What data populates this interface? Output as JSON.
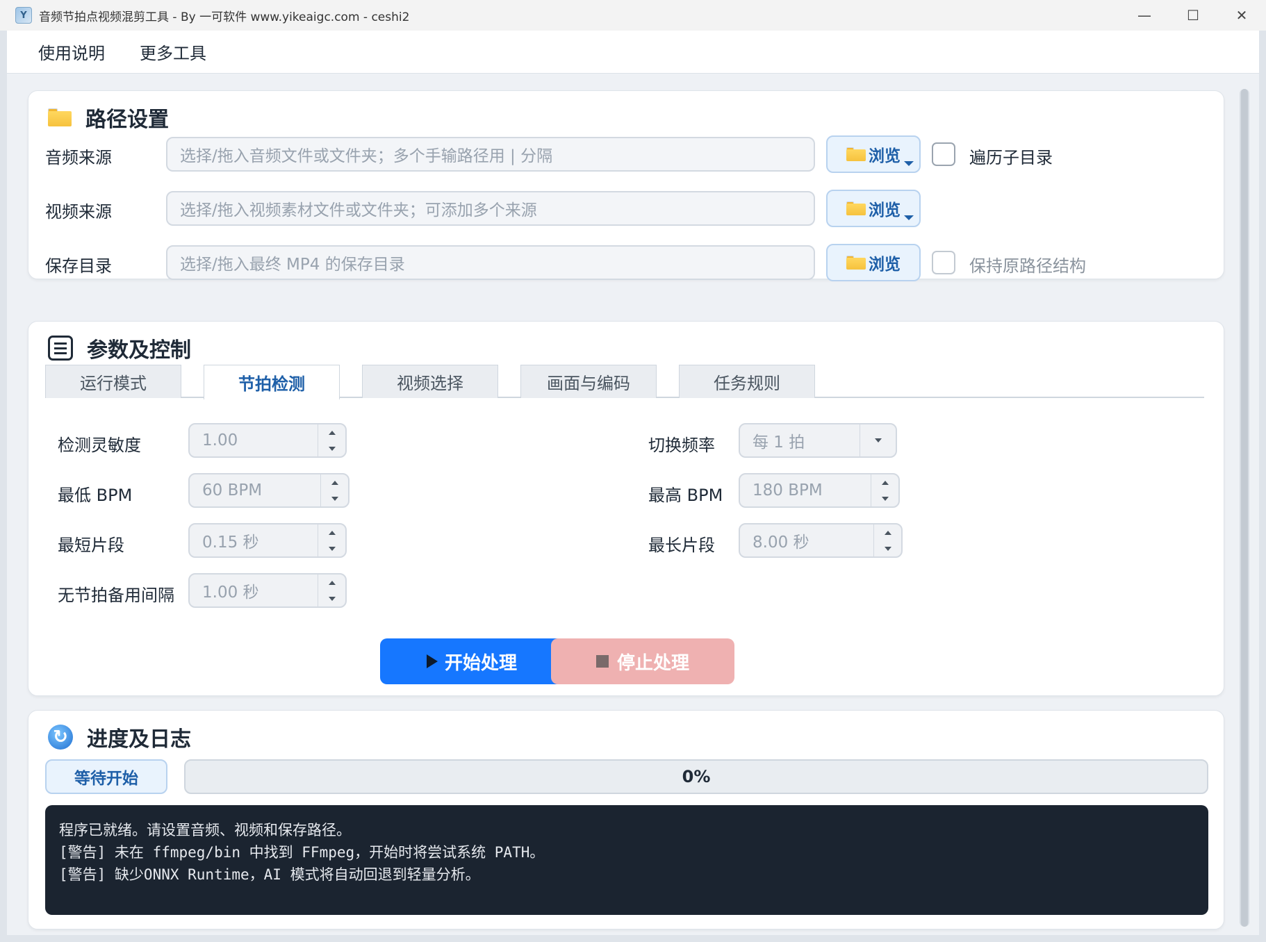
{
  "window": {
    "title": "音频节拍点视频混剪工具 - By 一可软件 www.yikeaigc.com - ceshi2",
    "minimize": "—",
    "maximize": "☐",
    "close": "✕"
  },
  "menu": [
    "使用说明",
    "更多工具"
  ],
  "paths": {
    "title": "路径设置",
    "audio": {
      "label": "音频来源",
      "placeholder": "选择/拖入音频文件或文件夹；多个手输路径用 | 分隔",
      "browse": "浏览",
      "checkbox": "遍历子目录",
      "checked": false
    },
    "video": {
      "label": "视频来源",
      "placeholder": "选择/拖入视频素材文件或文件夹；可添加多个来源",
      "browse": "浏览"
    },
    "save": {
      "label": "保存目录",
      "placeholder": "选择/拖入最终 MP4 的保存目录",
      "browse": "浏览",
      "checkbox": "保持原路径结构",
      "checked": false
    }
  },
  "params": {
    "title": "参数及控制",
    "tabs": [
      "运行模式",
      "节拍检测",
      "视频选择",
      "画面与编码",
      "任务规则"
    ],
    "active_tab": 1,
    "left": [
      {
        "label": "检测灵敏度",
        "value": "1.00"
      },
      {
        "label": "最低 BPM",
        "value": "60 BPM"
      },
      {
        "label": "最短片段",
        "value": "0.15 秒"
      },
      {
        "label": "无节拍备用间隔",
        "value": "1.00 秒"
      }
    ],
    "right": [
      {
        "label": "切换频率",
        "value": "每 1 拍",
        "type": "select"
      },
      {
        "label": "最高 BPM",
        "value": "180 BPM"
      },
      {
        "label": "最长片段",
        "value": "8.00 秒"
      }
    ],
    "start_label": "开始处理",
    "stop_label": "停止处理"
  },
  "progress": {
    "title": "进度及日志",
    "status": "等待开始",
    "percent_text": "0%",
    "percent": 0,
    "log": [
      "程序已就绪。请设置音频、视频和保存路径。",
      "[警告] 未在 ffmpeg/bin 中找到 FFmpeg，开始时将尝试系统 PATH。",
      "[警告] 缺少ONNX Runtime，AI 模式将自动回退到轻量分析。"
    ]
  },
  "colors": {
    "accent": "#1677ff",
    "stop": "#efb1b1",
    "log_bg": "#1b2430"
  }
}
